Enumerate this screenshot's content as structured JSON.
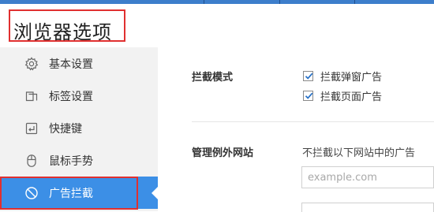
{
  "window": {
    "title": "浏览器选项"
  },
  "sidebar": {
    "items": [
      {
        "label": "基本设置",
        "icon": "gear-icon"
      },
      {
        "label": "标签设置",
        "icon": "tabs-icon"
      },
      {
        "label": "快捷键",
        "icon": "shortcut-key-icon"
      },
      {
        "label": "鼠标手势",
        "icon": "mouse-icon"
      },
      {
        "label": "广告拦截",
        "icon": "block-icon",
        "active": true
      }
    ]
  },
  "ad_block": {
    "mode": {
      "label": "拦截模式",
      "options": [
        {
          "label": "拦截弹窗广告",
          "checked": true
        },
        {
          "label": "拦截页面广告",
          "checked": true
        }
      ]
    },
    "exceptions": {
      "label": "管理例外网站",
      "hint": "不拦截以下网站中的广告",
      "input_placeholder": "example.com",
      "input_value": ""
    }
  },
  "colors": {
    "accent": "#3c8fe6",
    "highlight_border": "#e03030",
    "sidebar_bg": "#f2f2f2",
    "top_strip": "#3d7ecb"
  }
}
